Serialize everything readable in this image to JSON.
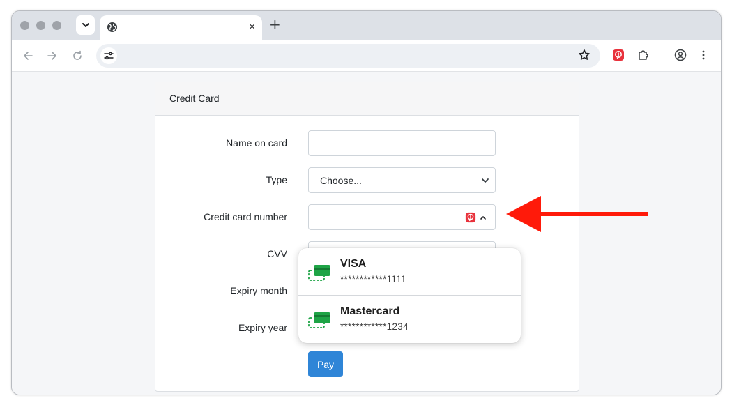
{
  "browser": {
    "tab_title": "",
    "new_tab_label": "+",
    "tab_close_label": "×",
    "address": "",
    "icons": {
      "tab_list": "chevron-down-icon",
      "tab_favicon": "globe-icon",
      "back": "arrow-left-icon",
      "forward": "arrow-right-icon",
      "reload": "reload-icon",
      "site_info": "tune-icon",
      "bookmark": "star-icon",
      "password_manager": "password-manager-icon",
      "extensions": "puzzle-icon",
      "profile": "profile-icon",
      "menu": "kebab-menu-icon"
    }
  },
  "form": {
    "title": "Credit Card",
    "labels": {
      "name": "Name on card",
      "type": "Type",
      "number": "Credit card number",
      "cvv": "CVV",
      "expiry_month": "Expiry month",
      "expiry_year": "Expiry year"
    },
    "name_value": "",
    "type_value": "Choose...",
    "number_value": "",
    "pay_label": "Pay"
  },
  "autofill": {
    "cards": [
      {
        "name": "VISA",
        "number": "************1111"
      },
      {
        "name": "Mastercard",
        "number": "************1234"
      }
    ]
  },
  "colors": {
    "accent": "#2f85d7",
    "card_icon": "#1ea446",
    "pm_icon": "#e8323c",
    "arrow": "#ff1a0a"
  }
}
